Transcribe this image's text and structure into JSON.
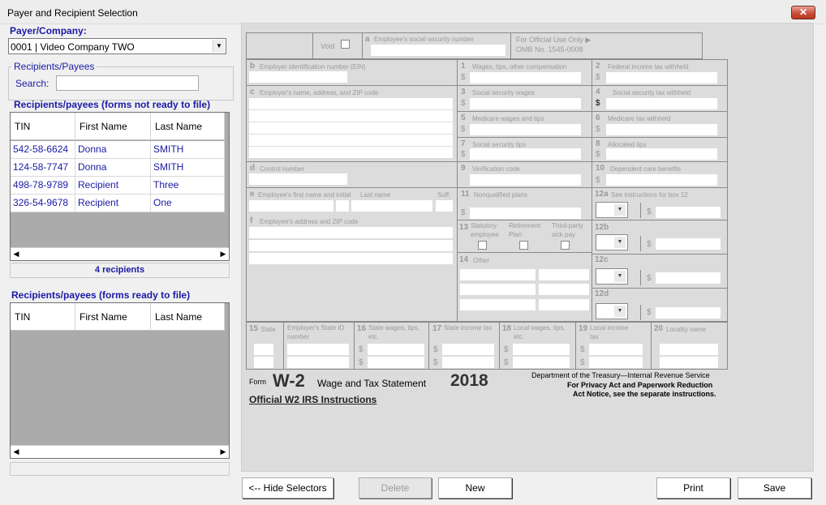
{
  "window": {
    "title": "Payer and Recipient Selection",
    "close_glyph": "✕"
  },
  "payer": {
    "label": "Payer/Company:",
    "selected": "0001 | Video Company TWO"
  },
  "recipients_group": {
    "label": "Recipients/Payees",
    "search_label": "Search:",
    "search_value": ""
  },
  "not_ready": {
    "title": "Recipients/payees (forms not ready to file)",
    "columns": [
      "TIN",
      "First Name",
      "Last Name"
    ],
    "rows": [
      [
        "542-58-6624",
        "Donna",
        "SMITH"
      ],
      [
        "124-58-7747",
        "Donna",
        "SMITH"
      ],
      [
        "498-78-9789",
        "Recipient",
        "Three"
      ],
      [
        "326-54-9678",
        "Recipient",
        "One"
      ]
    ],
    "count": "4 recipients"
  },
  "ready": {
    "title": "Recipients/payees (forms ready to file)",
    "columns": [
      "TIN",
      "First Name",
      "Last Name"
    ],
    "count": ""
  },
  "w2": {
    "void": "Void",
    "a": {
      "num": "a",
      "label": "Employee's social security number"
    },
    "official": "For Official Use Only ▶",
    "omb": "OMB No. 1545-0008",
    "b": {
      "num": "b",
      "label": "Employer identification number (EIN)"
    },
    "c": {
      "num": "c",
      "label": "Employer's name, address, and ZIP code"
    },
    "d": {
      "num": "d",
      "label": "Control number"
    },
    "e": {
      "num": "e",
      "label": "Employee's first name and initial",
      "last": "Last name",
      "suff": "Suff."
    },
    "f": {
      "num": "f",
      "label": "Employee's address and ZIP code"
    },
    "box1": {
      "num": "1",
      "label": "Wages, tips, other compensation"
    },
    "box2": {
      "num": "2",
      "label": "Federal income tax withheld"
    },
    "box3": {
      "num": "3",
      "label": "Social security wages"
    },
    "box4": {
      "num": "4",
      "label": "Social security tax withheld"
    },
    "box5": {
      "num": "5",
      "label": "Medicare wages and tips"
    },
    "box6": {
      "num": "6",
      "label": "Medicare tax withheld"
    },
    "box7": {
      "num": "7",
      "label": "Social security tips"
    },
    "box8": {
      "num": "8",
      "label": "Allocated tips"
    },
    "box9": {
      "num": "9",
      "label": "Verification code"
    },
    "box10": {
      "num": "10",
      "label": "Dependent care benefits"
    },
    "box11": {
      "num": "11",
      "label": "Nonqualified plans"
    },
    "box12a": {
      "num": "12a",
      "label": "See instructions for box 12"
    },
    "box12b": {
      "num": "12b"
    },
    "box12c": {
      "num": "12c"
    },
    "box12d": {
      "num": "12d"
    },
    "box13": {
      "num": "13",
      "statutory": "Statutory employee",
      "retirement": "Retirement Plan",
      "thirdparty": "Third-party sick pay"
    },
    "box14": {
      "num": "14",
      "label": "Other"
    },
    "box15": {
      "num": "15",
      "label": "State",
      "ein": "Employer's State ID number"
    },
    "box16": {
      "num": "16",
      "label": "State wages, tips, etc."
    },
    "box17": {
      "num": "17",
      "label": "State income tax"
    },
    "box18": {
      "num": "18",
      "label": "Local wages, tips, etc."
    },
    "box19": {
      "num": "19",
      "label": "Local income tax"
    },
    "box20": {
      "num": "20",
      "label": "Locality name"
    },
    "dollar": "$",
    "form_word": "Form",
    "form_name": "W-2",
    "form_title": "Wage and Tax Statement",
    "year": "2018",
    "dept": "Department of the Treasury—Internal Revenue Service",
    "privacy1": "For Privacy Act and Paperwork Reduction",
    "privacy2": "Act Notice, see the separate instructions.",
    "instructions_link": "Official W2 IRS Instructions"
  },
  "buttons": {
    "hide": "<-- Hide Selectors",
    "delete": "Delete",
    "new": "New",
    "print": "Print",
    "save": "Save"
  }
}
